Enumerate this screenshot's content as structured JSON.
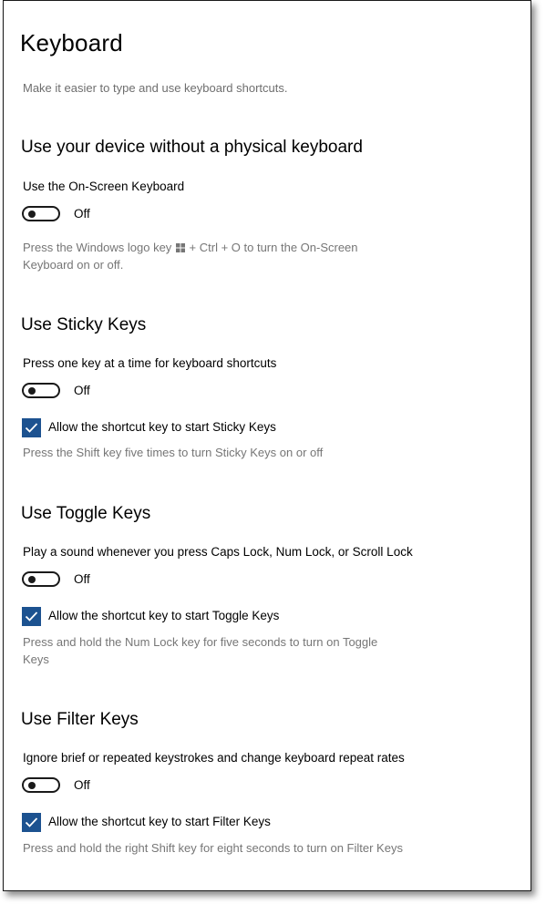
{
  "header": {
    "title": "Keyboard",
    "description": "Make it easier to type and use keyboard shortcuts."
  },
  "osk": {
    "section_title": "Use your device without a physical keyboard",
    "label": "Use the On-Screen Keyboard",
    "toggle_state": "Off",
    "help_before_icon": "Press the Windows logo key",
    "help_icon": "windows-logo-icon",
    "help_after_icon": "+ Ctrl + O to turn the On-Screen",
    "help_line2": "Keyboard on or off."
  },
  "sticky": {
    "section_title": "Use Sticky Keys",
    "label": "Press one key at a time for keyboard shortcuts",
    "toggle_state": "Off",
    "checkbox_label": "Allow the shortcut key to start Sticky Keys",
    "checkbox_checked": true,
    "help": "Press the Shift key five times to turn Sticky Keys on or off"
  },
  "toggle_keys": {
    "section_title": "Use Toggle Keys",
    "label": "Play a sound whenever you press Caps Lock, Num Lock, or Scroll Lock",
    "toggle_state": "Off",
    "checkbox_label": "Allow the shortcut key to start Toggle Keys",
    "checkbox_checked": true,
    "help_line1": "Press and hold the Num Lock key for five seconds to turn on Toggle",
    "help_line2": "Keys"
  },
  "filter": {
    "section_title": "Use Filter Keys",
    "label": "Ignore brief or repeated keystrokes and change keyboard repeat rates",
    "toggle_state": "Off",
    "checkbox_label": "Allow the shortcut key to start Filter Keys",
    "checkbox_checked": true,
    "help": "Press and hold the right Shift key for eight seconds to turn on Filter Keys"
  },
  "colors": {
    "accent": "#1c5290",
    "text": "#000000",
    "secondary_text": "#767676"
  }
}
